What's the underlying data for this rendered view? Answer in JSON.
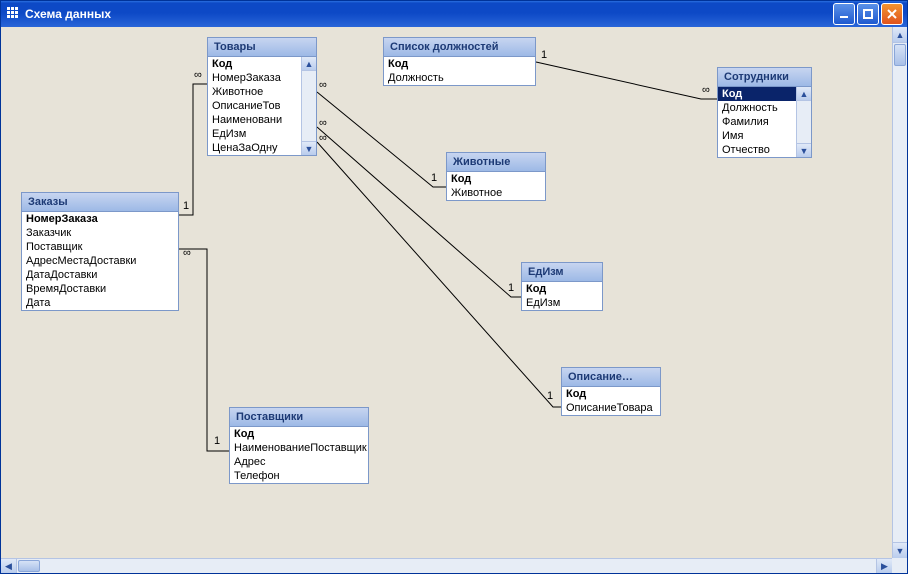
{
  "window": {
    "title": "Схема данных"
  },
  "tables": {
    "zakazy": {
      "title": "Заказы",
      "fields": [
        {
          "label": "НомерЗаказа",
          "bold": true
        },
        {
          "label": "Заказчик"
        },
        {
          "label": "Поставщик"
        },
        {
          "label": "АдресМестаДоставки"
        },
        {
          "label": "ДатаДоставки"
        },
        {
          "label": "ВремяДоставки"
        },
        {
          "label": "Дата"
        }
      ]
    },
    "tovary": {
      "title": "Товары",
      "fields": [
        {
          "label": "Код",
          "bold": true
        },
        {
          "label": "НомерЗаказа"
        },
        {
          "label": "Животное"
        },
        {
          "label": "ОписаниеТов"
        },
        {
          "label": "Наименовани"
        },
        {
          "label": "ЕдИзм"
        },
        {
          "label": "ЦенаЗаОдну"
        }
      ],
      "scroll": true
    },
    "spisok": {
      "title": "Список должностей",
      "fields": [
        {
          "label": "Код",
          "bold": true
        },
        {
          "label": "Должность"
        }
      ]
    },
    "sotrudniki": {
      "title": "Сотрудники",
      "fields": [
        {
          "label": "Код",
          "bold": true,
          "selected": true
        },
        {
          "label": "Должность"
        },
        {
          "label": "Фамилия"
        },
        {
          "label": "Имя"
        },
        {
          "label": "Отчество"
        }
      ],
      "scroll": true
    },
    "zhivotnye": {
      "title": "Животные",
      "fields": [
        {
          "label": "Код",
          "bold": true
        },
        {
          "label": "Животное"
        }
      ]
    },
    "edizm": {
      "title": "ЕдИзм",
      "fields": [
        {
          "label": "Код",
          "bold": true
        },
        {
          "label": "ЕдИзм"
        }
      ]
    },
    "opisanie": {
      "title": "Описание…",
      "fields": [
        {
          "label": "Код",
          "bold": true
        },
        {
          "label": "ОписаниеТовара"
        }
      ]
    },
    "postavshiki": {
      "title": "Поставщики",
      "fields": [
        {
          "label": "Код",
          "bold": true
        },
        {
          "label": "НаименованиеПоставщик"
        },
        {
          "label": "Адрес"
        },
        {
          "label": "Телефон"
        }
      ]
    }
  },
  "rel_labels": {
    "one": "1",
    "many": "∞"
  },
  "relationships": [
    {
      "from": "zakazy",
      "to": "tovary",
      "from_card": "1",
      "to_card": "many"
    },
    {
      "from": "zakazy",
      "to": "postavshiki",
      "from_card": "many",
      "to_card": "1"
    },
    {
      "from": "tovary",
      "to": "zhivotnye",
      "from_card": "many",
      "to_card": "1"
    },
    {
      "from": "tovary",
      "to": "edizm",
      "from_card": "many",
      "to_card": "1"
    },
    {
      "from": "tovary",
      "to": "opisanie",
      "from_card": "many",
      "to_card": "1"
    },
    {
      "from": "spisok",
      "to": "sotrudniki",
      "from_card": "1",
      "to_card": "many"
    }
  ]
}
